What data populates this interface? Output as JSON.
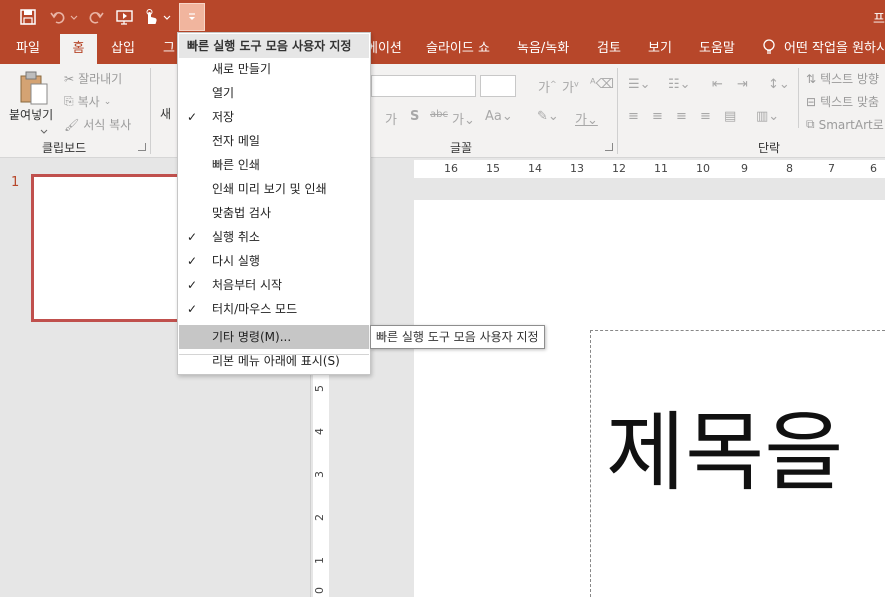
{
  "title_fragment": "프",
  "tabs": {
    "file": "파일",
    "home": "홈",
    "insert": "삽입",
    "design_frag": "그",
    "transitions_frag": "에이션",
    "slideshow": "슬라이드 쇼",
    "record": "녹음/녹화",
    "review": "검토",
    "view": "보기",
    "help": "도움말",
    "tell_me": "어떤 작업을 원하시"
  },
  "ribbon": {
    "paste": "붙여넣기",
    "cut": "잘라내기",
    "copy": "복사",
    "format_painter": "서식 복사",
    "new_slide_frag": "새",
    "text_direction": "텍스트 방향",
    "align_text": "텍스트 맞춤",
    "smartart": "SmartArt로",
    "groups": {
      "clipboard": "클립보드",
      "font": "글꼴",
      "paragraph": "단락"
    }
  },
  "qat_menu": {
    "header": "빠른 실행 도구 모음 사용자 지정",
    "items": [
      {
        "label": "새로 만들기",
        "checked": false
      },
      {
        "label": "열기",
        "checked": false
      },
      {
        "label": "저장",
        "checked": true
      },
      {
        "label": "전자 메일",
        "checked": false
      },
      {
        "label": "빠른 인쇄",
        "checked": false
      },
      {
        "label": "인쇄 미리 보기 및 인쇄",
        "checked": false
      },
      {
        "label": "맞춤법 검사",
        "checked": false
      },
      {
        "label": "실행 취소",
        "checked": true
      },
      {
        "label": "다시 실행",
        "checked": true
      },
      {
        "label": "처음부터 시작",
        "checked": true
      },
      {
        "label": "터치/마우스 모드",
        "checked": true
      }
    ],
    "more_commands": "기타 명령(M)...",
    "show_below": "리본 메뉴 아래에 표시(S)",
    "check_mark": "✓"
  },
  "tooltip": "빠른 실행 도구 모음 사용자 지정",
  "slide": {
    "number": "1",
    "title_text": "제목을"
  },
  "hruler": {
    "labels": [
      "16",
      "15",
      "14",
      "13",
      "12",
      "11",
      "10",
      "9",
      "8",
      "7",
      "6"
    ]
  },
  "vruler": {
    "labels": [
      "5",
      "4",
      "3",
      "2",
      "1",
      "0"
    ]
  },
  "colors": {
    "accent": "#b7472a",
    "ribbon_bg": "#f3f2f1"
  }
}
